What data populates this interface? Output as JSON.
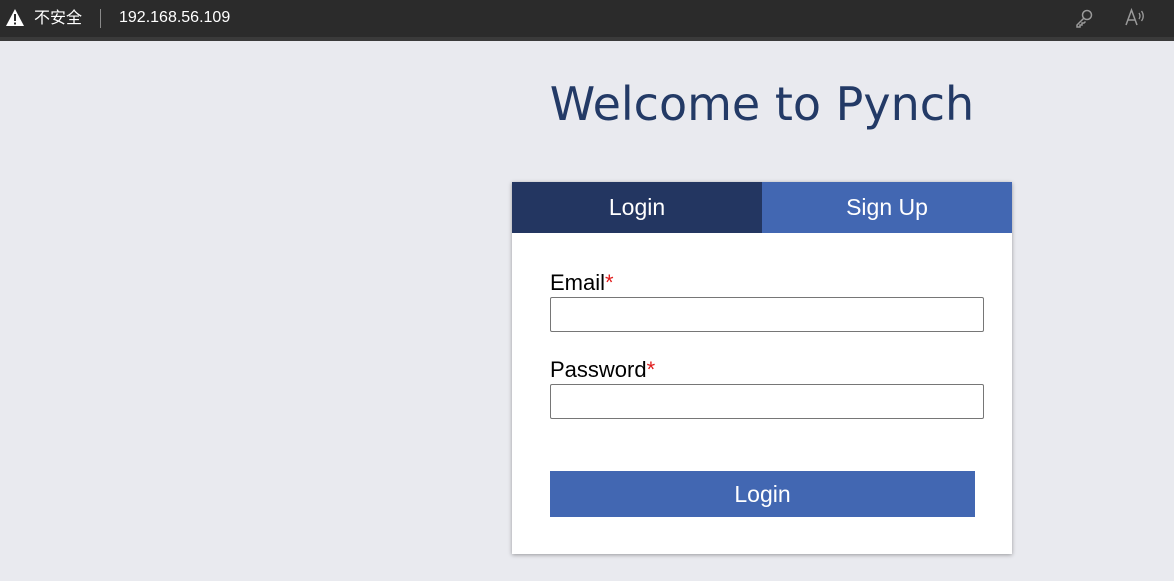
{
  "browser": {
    "security_label": "不安全",
    "url": "192.168.56.109",
    "icons": [
      "warning-icon",
      "key-icon",
      "read-aloud-icon"
    ]
  },
  "page": {
    "title": "Welcome to Pynch"
  },
  "tabs": [
    {
      "label": "Login",
      "active": true
    },
    {
      "label": "Sign Up",
      "active": false
    }
  ],
  "form": {
    "email_label": "Email",
    "password_label": "Password",
    "required_marker": "*",
    "email_value": "",
    "password_value": "",
    "submit_label": "Login"
  },
  "colors": {
    "title": "#233a66",
    "active_tab": "#233661",
    "inactive_tab": "#4267b2",
    "button": "#4267b2",
    "required": "#e01b1b",
    "background": "#e9eaef"
  }
}
